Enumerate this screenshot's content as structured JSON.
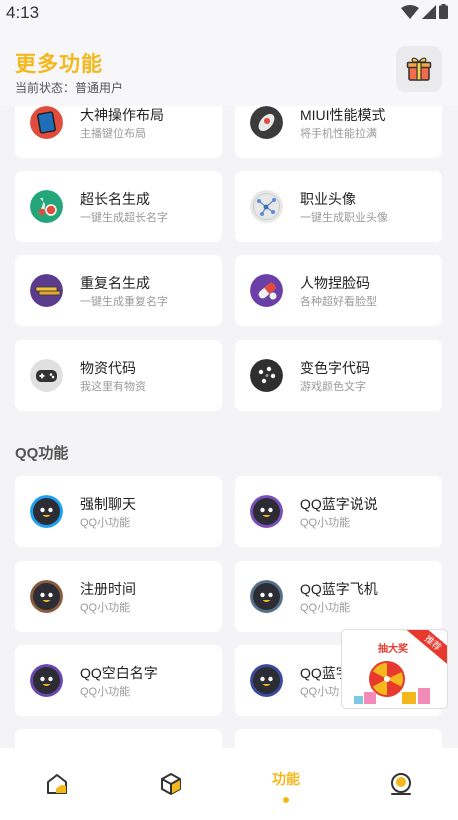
{
  "status_bar": {
    "time": "4:13"
  },
  "header": {
    "title": "更多功能",
    "status": "当前状态：普通用户"
  },
  "cards_top": [
    {
      "title": "大神操作布局",
      "sub": "主播键位布局",
      "icon": "tablet-icon"
    },
    {
      "title": "MIUI性能模式",
      "sub": "将手机性能拉满",
      "icon": "rocket-icon"
    },
    {
      "title": "超长名生成",
      "sub": "一键生成超长名字",
      "icon": "flask-icon"
    },
    {
      "title": "职业头像",
      "sub": "一键生成职业头像",
      "icon": "network-icon"
    },
    {
      "title": "重复名生成",
      "sub": "一键生成重复名字",
      "icon": "bars-icon"
    },
    {
      "title": "人物捏脸码",
      "sub": "各种超好看脸型",
      "icon": "capsule-icon"
    },
    {
      "title": "物资代码",
      "sub": "我这里有物资",
      "icon": "gamepad-icon"
    },
    {
      "title": "变色字代码",
      "sub": "游戏颜色文字",
      "icon": "palette-icon"
    }
  ],
  "qq_section": {
    "title": "QQ功能",
    "cards": [
      {
        "title": "强制聊天",
        "sub": "QQ小功能",
        "ring": "#1da1f2"
      },
      {
        "title": "QQ蓝字说说",
        "sub": "QQ小功能",
        "ring": "#7b4fb8"
      },
      {
        "title": "注册时间",
        "sub": "QQ小功能",
        "ring": "#8a5a3c"
      },
      {
        "title": "QQ蓝字飞机",
        "sub": "QQ小功能",
        "ring": "#56708a"
      },
      {
        "title": "QQ空白名字",
        "sub": "QQ小功能",
        "ring": "#6b45b0"
      },
      {
        "title": "QQ蓝字",
        "sub": "QQ小功",
        "ring": "#3b4a9a"
      }
    ]
  },
  "promo": {
    "label": "抽大奖",
    "ribbon": "推荐"
  },
  "nav": {
    "items": [
      {
        "icon": "home-icon"
      },
      {
        "icon": "cube-icon"
      },
      {
        "label": "功能",
        "active": true
      },
      {
        "icon": "profile-icon"
      }
    ]
  },
  "colors": {
    "accent": "#f5b81c",
    "background": "#f4f4f6"
  }
}
